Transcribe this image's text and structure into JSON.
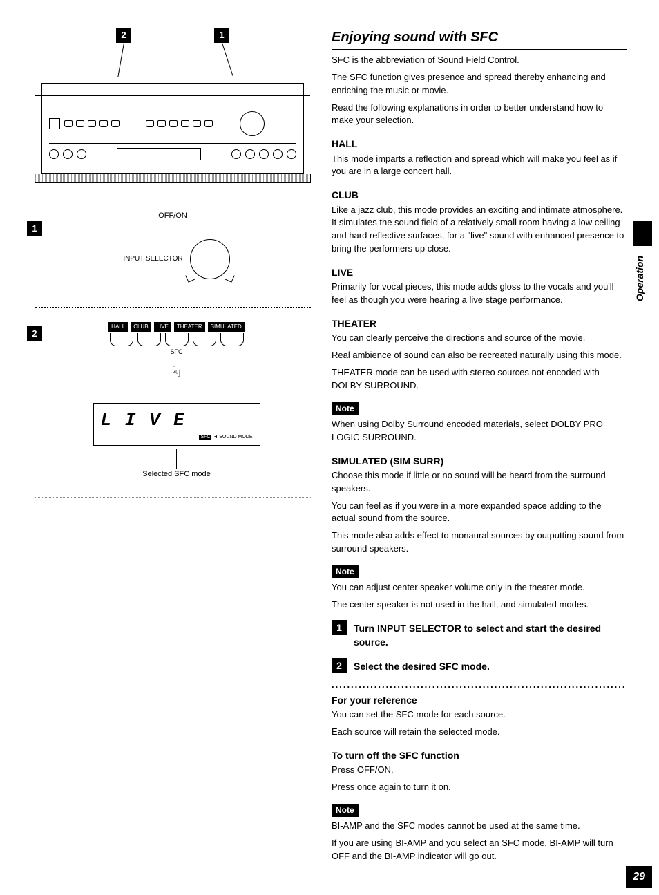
{
  "sidetab": "Operation",
  "pageNumber": "29",
  "left": {
    "callout1": "1",
    "callout2": "2",
    "offOn": "OFF/ON",
    "inputSelector": "INPUT SELECTOR",
    "sfcModes": {
      "a": "HALL",
      "b": "CLUB",
      "c": "LIVE",
      "d": "THEATER",
      "e": "SIMULATED"
    },
    "sfcLabel": "SFC",
    "lcdText": "L I V E",
    "lcdSubBadge": "SFC",
    "lcdSubText": "◄ SOUND MODE",
    "lcdCaption": "Selected SFC mode"
  },
  "right": {
    "title": "Enjoying sound with SFC",
    "intro1": "SFC is the abbreviation of Sound Field Control.",
    "intro2": "The SFC function gives presence and spread thereby enhancing and enriching the music or movie.",
    "intro3": "Read the following explanations in order to better understand how to make your selection.",
    "hallH": "HALL",
    "hall": "This mode imparts a reflection and spread which will make you feel as if you are in a large concert hall.",
    "clubH": "CLUB",
    "club": "Like a jazz club, this mode provides an exciting and intimate atmosphere. It simulates the sound field of a relatively small room having a low ceiling and hard reflective surfaces, for a \"live\" sound with enhanced presence to bring the performers up close.",
    "liveH": "LIVE",
    "live": "Primarily for vocal pieces, this mode adds gloss to the vocals and you'll feel as though you were hearing a live stage performance.",
    "theaterH": "THEATER",
    "theater1": "You can clearly perceive the directions and source of the movie.",
    "theater2": "Real ambience of sound can also be recreated naturally using this mode.",
    "theater3": "THEATER mode can be used with stereo sources not encoded with DOLBY SURROUND.",
    "note": "Note",
    "note1": "When using Dolby Surround encoded materials, select DOLBY PRO LOGIC SURROUND.",
    "simH": "SIMULATED (SIM SURR)",
    "sim1": "Choose this mode if little or no sound will be heard from the surround speakers.",
    "sim2": "You can feel as if you were in a more expanded space adding to the actual sound from the source.",
    "sim3": "This mode also adds effect to monaural sources by outputting sound from surround speakers.",
    "note2a": "You can adjust center speaker volume only in the theater mode.",
    "note2b": "The center speaker is not used in the hall, and simulated modes.",
    "step1": "Turn INPUT SELECTOR to select and start the desired source.",
    "step2": "Select the desired SFC mode.",
    "refH": "For your reference",
    "ref1": "You can set the SFC mode for each source.",
    "ref2": "Each source will retain the selected mode.",
    "offH": "To turn off the SFC function",
    "off1": "Press OFF/ON.",
    "off2": "Press once again to turn it on.",
    "note3a": "BI-AMP and the SFC modes cannot be used at the same time.",
    "note3b": "If you are using BI-AMP and you select an SFC mode, BI-AMP will turn OFF and the BI-AMP indicator will go out."
  }
}
